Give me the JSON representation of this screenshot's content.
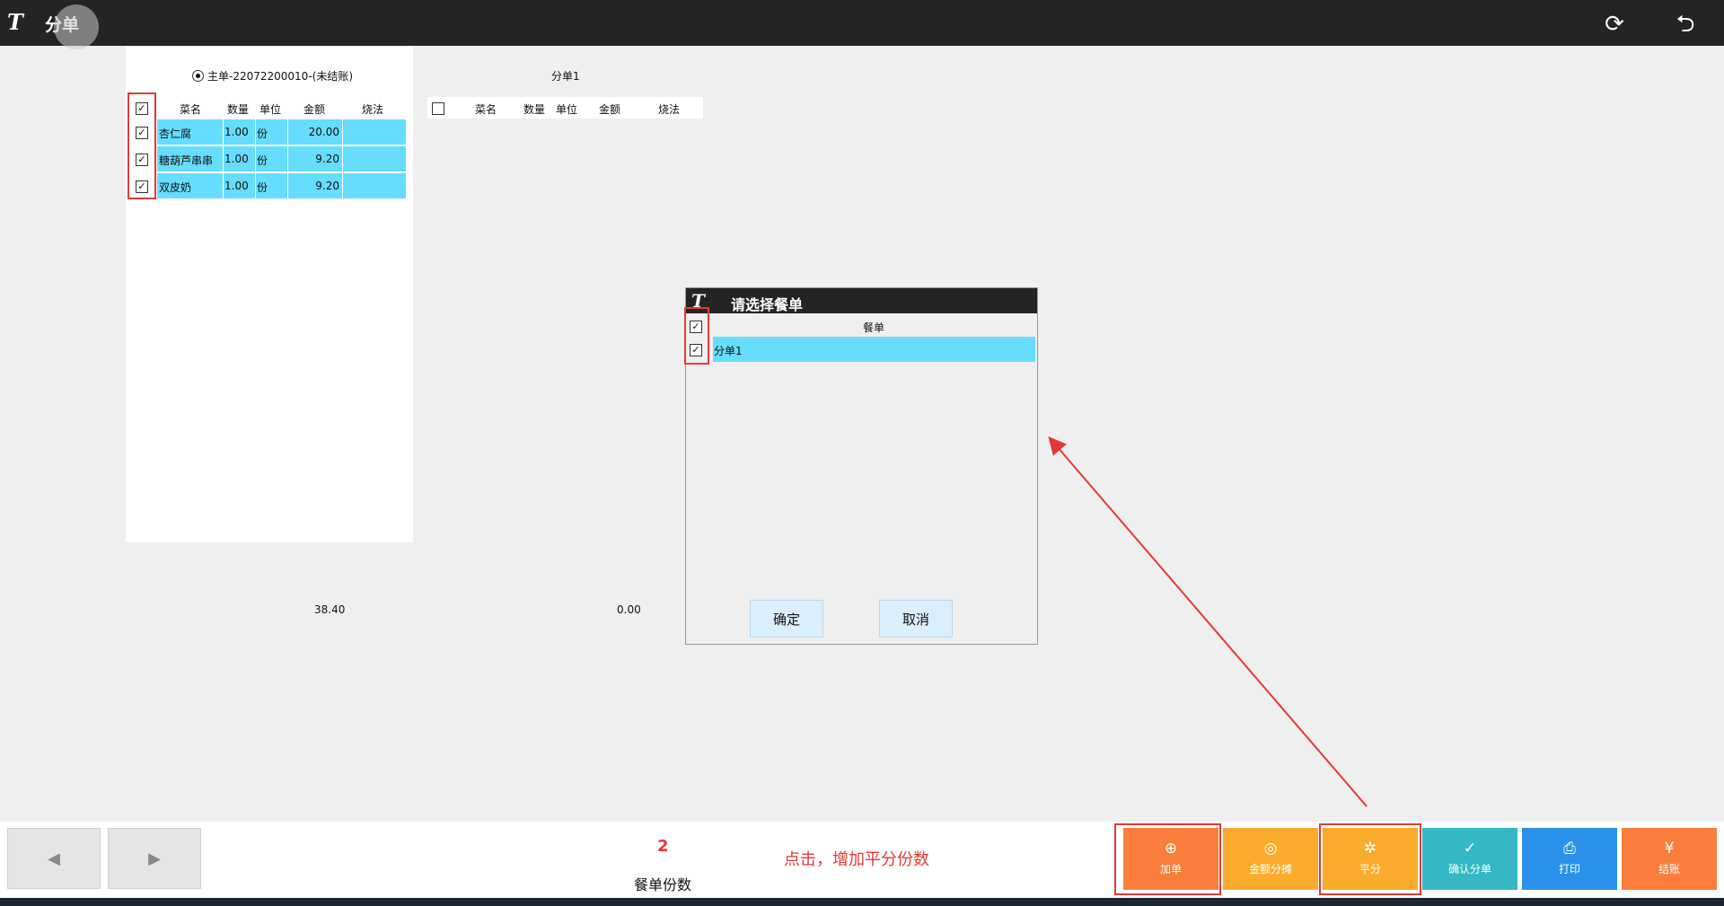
{
  "header": {
    "logo": "T",
    "title": "分单"
  },
  "main_bill": {
    "title": "主单-22072200010-(未结账)",
    "columns": [
      "菜名",
      "数量",
      "单位",
      "金额",
      "烧法"
    ],
    "rows": [
      {
        "name": "杏仁腐",
        "qty": "1.00",
        "unit": "份",
        "amount": "20.00",
        "method": ""
      },
      {
        "name": "糖葫芦串串",
        "qty": "1.00",
        "unit": "份",
        "amount": "9.20",
        "method": ""
      },
      {
        "name": "双皮奶",
        "qty": "1.00",
        "unit": "份",
        "amount": "9.20",
        "method": ""
      }
    ],
    "total": "38.40"
  },
  "split_bill": {
    "title": "分单1",
    "columns": [
      "菜名",
      "数量",
      "单位",
      "金额",
      "烧法"
    ],
    "total": "0.00"
  },
  "dialog": {
    "title": "请选择餐单",
    "column": "餐单",
    "rows": [
      "分单1"
    ],
    "ok_label": "确定",
    "cancel_label": "取消"
  },
  "bottom": {
    "count_value": "2",
    "count_label": "餐单份数",
    "annotation": "点击，增加平分份数",
    "actions": [
      {
        "label": "加单",
        "icon": "plus-circle-icon",
        "glyph": "⊕",
        "color": "#fb7d3c"
      },
      {
        "label": "金额分摊",
        "icon": "coins-icon",
        "glyph": "◎",
        "color": "#fbab2c"
      },
      {
        "label": "平分",
        "icon": "split-icon",
        "glyph": "✲",
        "color": "#fbab2c"
      },
      {
        "label": "确认分单",
        "icon": "check-circle-icon",
        "glyph": "✓",
        "color": "#35b8c4"
      },
      {
        "label": "打印",
        "icon": "printer-icon",
        "glyph": "⎙",
        "color": "#2a91ea"
      },
      {
        "label": "结账",
        "icon": "yen-icon",
        "glyph": "¥",
        "color": "#fb7d3c"
      }
    ]
  },
  "colors": {
    "header": "#242424",
    "row_highlight": "#66ddff",
    "annotation": "#e53935"
  }
}
